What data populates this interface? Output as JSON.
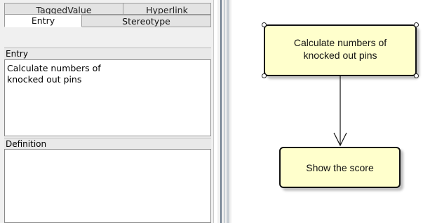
{
  "panel": {
    "tabs_back": [
      "TaggedValue",
      "Hyperlink"
    ],
    "tabs_front": [
      "Entry",
      "Stereotype"
    ],
    "entry_label": "Entry",
    "entry_text": "Calculate numbers of\nknocked out pins",
    "definition_label": "Definition",
    "definition_text": ""
  },
  "diagram": {
    "node1": "Calculate numbers of\nknocked out pins",
    "node2": "Show the score",
    "node_fill": "#ffffcc",
    "border_color": "#111111"
  }
}
